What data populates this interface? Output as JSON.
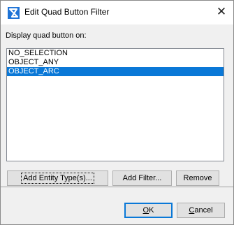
{
  "window": {
    "title": "Edit Quad Button Filter",
    "close_glyph": "✕",
    "icon": "app-logo-icon"
  },
  "prompt_label": "Display quad button on:",
  "list": {
    "items": [
      {
        "label": "NO_SELECTION",
        "selected": false
      },
      {
        "label": "OBJECT_ANY",
        "selected": false
      },
      {
        "label": "OBJECT_ARC",
        "selected": true
      }
    ]
  },
  "buttons": {
    "add_entity_type": "Add Entity Type(s)...",
    "add_filter": "Add Filter...",
    "remove": "Remove",
    "ok_mnemonic": "O",
    "ok_rest": "K",
    "cancel_mnemonic": "C",
    "cancel_rest": "ancel"
  },
  "colors": {
    "selection": "#0a78d7",
    "dialog_background": "#f0f0f0",
    "app_icon": "#1e73d6"
  }
}
